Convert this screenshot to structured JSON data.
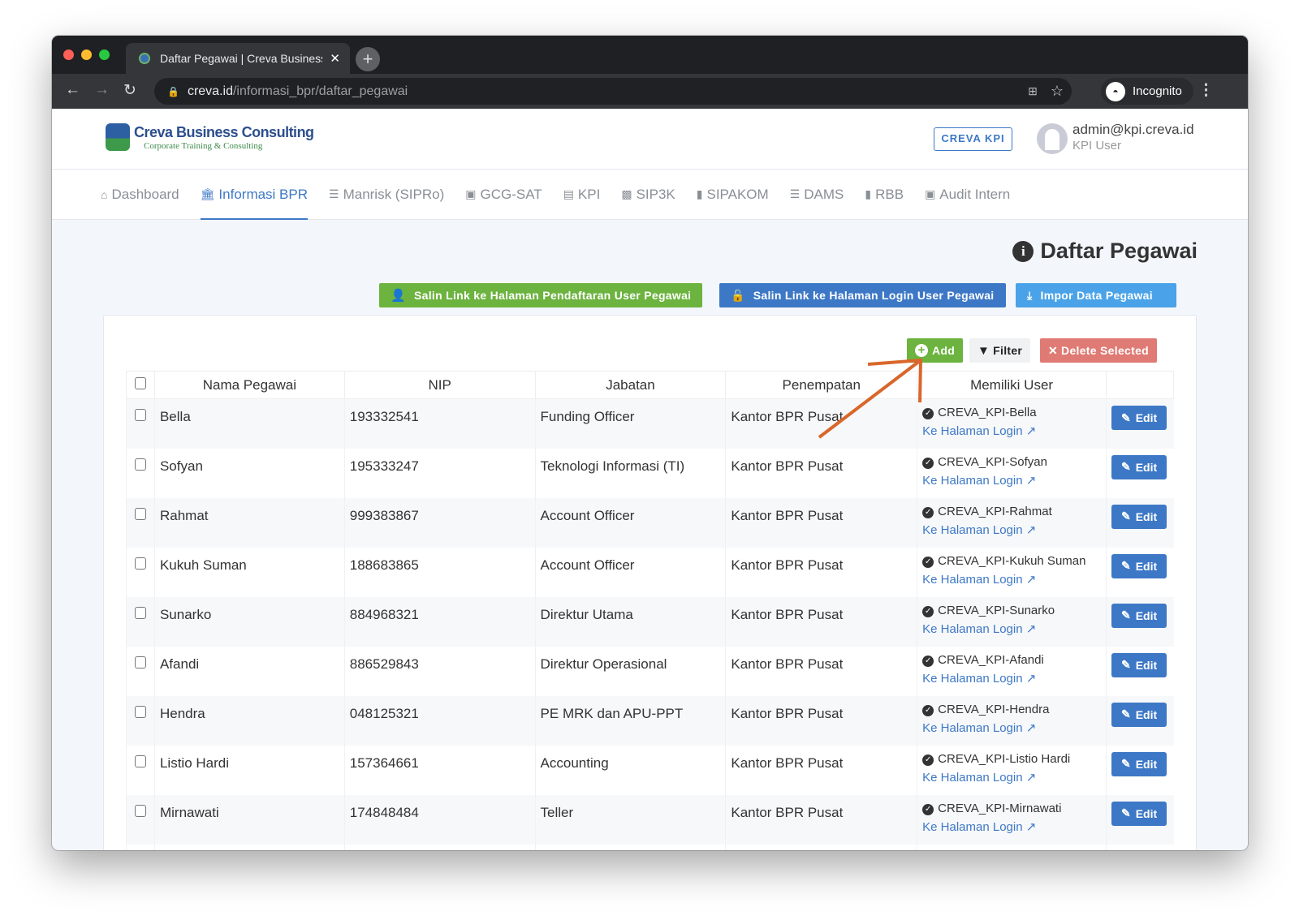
{
  "browser": {
    "tab_title": "Daftar Pegawai | Creva Business Consulting",
    "url_host": "creva.id",
    "url_path": "/informasi_bpr/daftar_pegawai",
    "profile": "Incognito"
  },
  "header": {
    "logo_title": "Creva Business Consulting",
    "logo_subtitle": "Corporate Training & Consulting",
    "app_button": "CREVA KPI",
    "user_email": "admin@kpi.creva.id",
    "user_role": "KPI User"
  },
  "nav": [
    {
      "label": "Dashboard",
      "icon": "home-icon"
    },
    {
      "label": "Informasi BPR",
      "icon": "bank-icon",
      "active": true
    },
    {
      "label": "Manrisk (SIPRo)",
      "icon": "list-icon"
    },
    {
      "label": "GCG-SAT",
      "icon": "clipboard-check-icon"
    },
    {
      "label": "KPI",
      "icon": "clipboard-list-icon"
    },
    {
      "label": "SIP3K",
      "icon": "id-card-icon"
    },
    {
      "label": "SIPAKOM",
      "icon": "book-icon"
    },
    {
      "label": "DAMS",
      "icon": "list-icon"
    },
    {
      "label": "RBB",
      "icon": "book-icon"
    },
    {
      "label": "Audit Intern",
      "icon": "clipboard-check-icon"
    }
  ],
  "page": {
    "title": "Daftar Pegawai",
    "actions": {
      "register_link": "Salin Link ke Halaman Pendaftaran User Pegawai",
      "login_link": "Salin Link ke Halaman Login User Pegawai",
      "import": "Impor Data Pegawai"
    },
    "toolbar": {
      "add": "Add",
      "filter": "Filter",
      "delete": "Delete Selected"
    }
  },
  "colors": {
    "green": "#6cb33f",
    "blue": "#3d78c6",
    "light_blue": "#4aa3e8",
    "red": "#e07a74",
    "arrow": "#d9662a"
  },
  "table": {
    "columns": [
      "Nama Pegawai",
      "NIP",
      "Jabatan",
      "Penempatan",
      "Memiliki User"
    ],
    "login_link": "Ke Halaman Login",
    "edit_label": "Edit",
    "rows": [
      {
        "nama": "Bella",
        "nip": "193332541",
        "jabatan": "Funding Officer",
        "penempatan": "Kantor BPR Pusat",
        "user": "CREVA_KPI-Bella"
      },
      {
        "nama": "Sofyan",
        "nip": "195333247",
        "jabatan": "Teknologi Informasi (TI)",
        "penempatan": "Kantor BPR Pusat",
        "user": "CREVA_KPI-Sofyan"
      },
      {
        "nama": "Rahmat",
        "nip": "999383867",
        "jabatan": "Account Officer",
        "penempatan": "Kantor BPR Pusat",
        "user": "CREVA_KPI-Rahmat"
      },
      {
        "nama": "Kukuh Suman",
        "nip": "188683865",
        "jabatan": "Account Officer",
        "penempatan": "Kantor BPR Pusat",
        "user": "CREVA_KPI-Kukuh Suman"
      },
      {
        "nama": "Sunarko",
        "nip": "884968321",
        "jabatan": "Direktur Utama",
        "penempatan": "Kantor BPR Pusat",
        "user": "CREVA_KPI-Sunarko"
      },
      {
        "nama": "Afandi",
        "nip": "886529843",
        "jabatan": "Direktur Operasional",
        "penempatan": "Kantor BPR Pusat",
        "user": "CREVA_KPI-Afandi"
      },
      {
        "nama": "Hendra",
        "nip": "048125321",
        "jabatan": "PE MRK dan APU-PPT",
        "penempatan": "Kantor BPR Pusat",
        "user": "CREVA_KPI-Hendra"
      },
      {
        "nama": "Listio Hardi",
        "nip": "157364661",
        "jabatan": "Accounting",
        "penempatan": "Kantor BPR Pusat",
        "user": "CREVA_KPI-Listio Hardi"
      },
      {
        "nama": "Mirnawati",
        "nip": "174848484",
        "jabatan": "Teller",
        "penempatan": "Kantor BPR Pusat",
        "user": "CREVA_KPI-Mirnawati"
      }
    ]
  }
}
